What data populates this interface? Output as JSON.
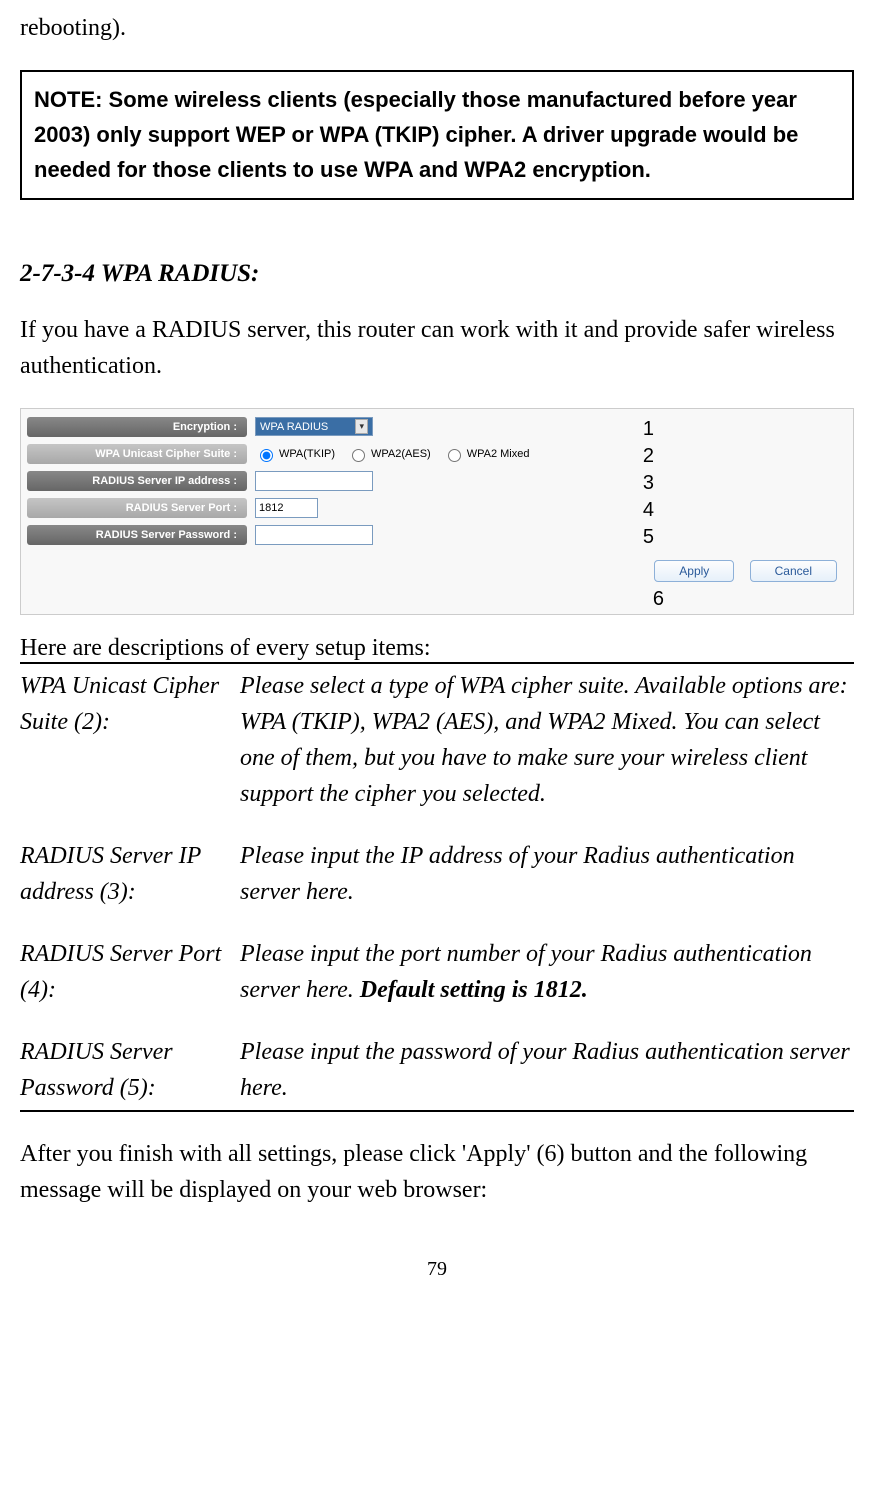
{
  "top_fragment": "rebooting).",
  "note_box": "NOTE: Some wireless clients (especially those manufactured before year 2003) only support WEP or WPA (TKIP) cipher. A driver upgrade would be needed for those clients to use WPA and WPA2 encryption.",
  "section_heading": "2-7-3-4 WPA RADIUS:",
  "intro_para": "If you have a RADIUS server, this router can work with it and provide safer wireless authentication.",
  "screenshot_form": {
    "encryption_label": "Encryption :",
    "encryption_value": "WPA RADIUS",
    "cipher_label": "WPA Unicast Cipher Suite :",
    "cipher_options": {
      "tkip": "WPA(TKIP)",
      "aes": "WPA2(AES)",
      "mixed": "WPA2 Mixed"
    },
    "radius_ip_label": "RADIUS Server IP address :",
    "radius_ip_value": "",
    "radius_port_label": "RADIUS Server Port :",
    "radius_port_value": "1812",
    "radius_pw_label": "RADIUS Server Password :",
    "radius_pw_value": "",
    "apply_btn": "Apply",
    "cancel_btn": "Cancel"
  },
  "callouts": {
    "c1": "1",
    "c2": "2",
    "c3": "3",
    "c4": "4",
    "c5": "5",
    "c6": "6"
  },
  "desc_caption": "Here are descriptions of every setup items:",
  "descriptions": {
    "d1_left": "WPA Unicast Cipher Suite (2):",
    "d1_right": "Please select a type of WPA cipher suite. Available options are: WPA (TKIP), WPA2 (AES), and WPA2 Mixed. You can select one of them, but you have to make sure your wireless client support the cipher you selected.",
    "d2_left": "RADIUS Server IP address (3):",
    "d2_right": "Please input the IP address of your Radius authentication server here.",
    "d3_left": "RADIUS Server Port (4):",
    "d3_right_a": "Please input the port number of your Radius authentication server here. ",
    "d3_right_b": "Default setting is 1812.",
    "d4_left": "RADIUS Server Password (5):",
    "d4_right": "Please input the password of your Radius authentication server here."
  },
  "outro_para": "After you finish with all settings, please click 'Apply' (6) button and the following message will be displayed on your web browser:",
  "page_number": "79"
}
